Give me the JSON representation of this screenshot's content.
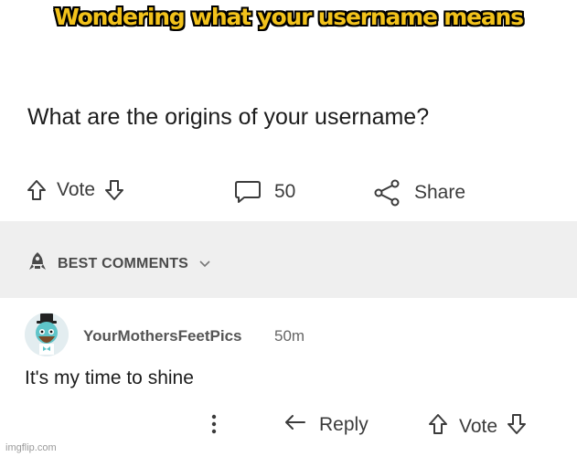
{
  "meme": {
    "caption": "Wondering what your username means"
  },
  "post": {
    "title": "What are the origins of your username?",
    "vote_label": "Vote",
    "comment_count": "50",
    "share_label": "Share"
  },
  "sort": {
    "label": "BEST COMMENTS"
  },
  "comment": {
    "author": "YourMothersFeetPics",
    "age": "50m",
    "text": "It's my time to shine",
    "reply_label": "Reply",
    "vote_label": "Vote"
  },
  "watermark": "imgflip.com",
  "icons": [
    "arrow-up-icon",
    "arrow-down-icon",
    "comment-bubble-icon",
    "share-icon",
    "rocket-icon",
    "chevron-down-icon",
    "avatar-snoo",
    "kebab-menu-icon",
    "reply-arrow-icon"
  ],
  "colors": {
    "caption_fill": "#f2c21b",
    "caption_outline": "#000000",
    "band": "#efefef"
  }
}
